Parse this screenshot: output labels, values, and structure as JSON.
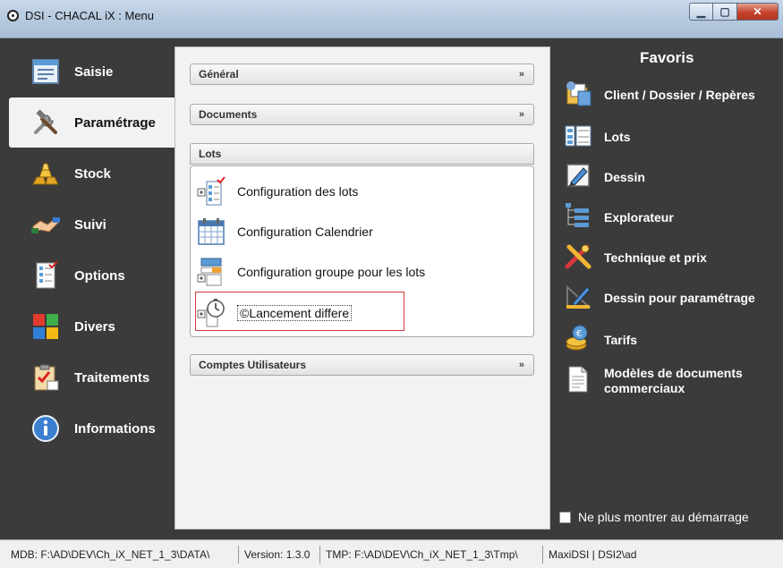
{
  "window": {
    "title": "DSI - CHACAL iX : Menu"
  },
  "nav": {
    "items": [
      {
        "label": "Saisie",
        "icon": "form-icon"
      },
      {
        "label": "Paramétrage",
        "icon": "tools-icon"
      },
      {
        "label": "Stock",
        "icon": "gold-bars-icon"
      },
      {
        "label": "Suivi",
        "icon": "handshake-icon"
      },
      {
        "label": "Options",
        "icon": "checklist-icon"
      },
      {
        "label": "Divers",
        "icon": "tiles-icon"
      },
      {
        "label": "Traitements",
        "icon": "clipboard-icon"
      },
      {
        "label": "Informations",
        "icon": "info-icon"
      }
    ],
    "active": "Paramétrage"
  },
  "sections": {
    "general": "Général",
    "documents": "Documents",
    "lots": "Lots",
    "comptes": "Comptes Utilisateurs",
    "chevron": "»"
  },
  "lots_items": [
    {
      "label": "Configuration des lots",
      "icon": "tree-checklist-icon"
    },
    {
      "label": "Configuration Calendrier",
      "icon": "calendar-icon"
    },
    {
      "label": "Configuration groupe pour les lots",
      "icon": "group-tree-icon"
    },
    {
      "label": "©Lancement differe",
      "icon": "stopwatch-icon"
    }
  ],
  "favorites": {
    "title": "Favoris",
    "items": [
      {
        "label": "Client / Dossier / Repères",
        "icon": "client-folder-icon"
      },
      {
        "label": "Lots",
        "icon": "lots-icon"
      },
      {
        "label": "Dessin",
        "icon": "drawing-icon"
      },
      {
        "label": "Explorateur",
        "icon": "explorer-icon"
      },
      {
        "label": "Technique et prix",
        "icon": "tools-price-icon"
      },
      {
        "label": "Dessin pour paramétrage",
        "icon": "draw-settings-icon"
      },
      {
        "label": "Tarifs",
        "icon": "coins-icon"
      },
      {
        "label": "Modèles de documents commerciaux",
        "icon": "document-icon"
      }
    ]
  },
  "startup_checkbox": {
    "label": "Ne plus montrer au démarrage",
    "checked": false
  },
  "status": {
    "mdb": "MDB: F:\\AD\\DEV\\Ch_iX_NET_1_3\\DATA\\",
    "version": "Version: 1.3.0",
    "tmp": "TMP: F:\\AD\\DEV\\Ch_iX_NET_1_3\\Tmp\\",
    "user": "MaxiDSI | DSI2\\ad"
  },
  "colors": {
    "background": "#3b3b3b",
    "panel": "#f2f2f2",
    "selection": "#d23b3b"
  }
}
